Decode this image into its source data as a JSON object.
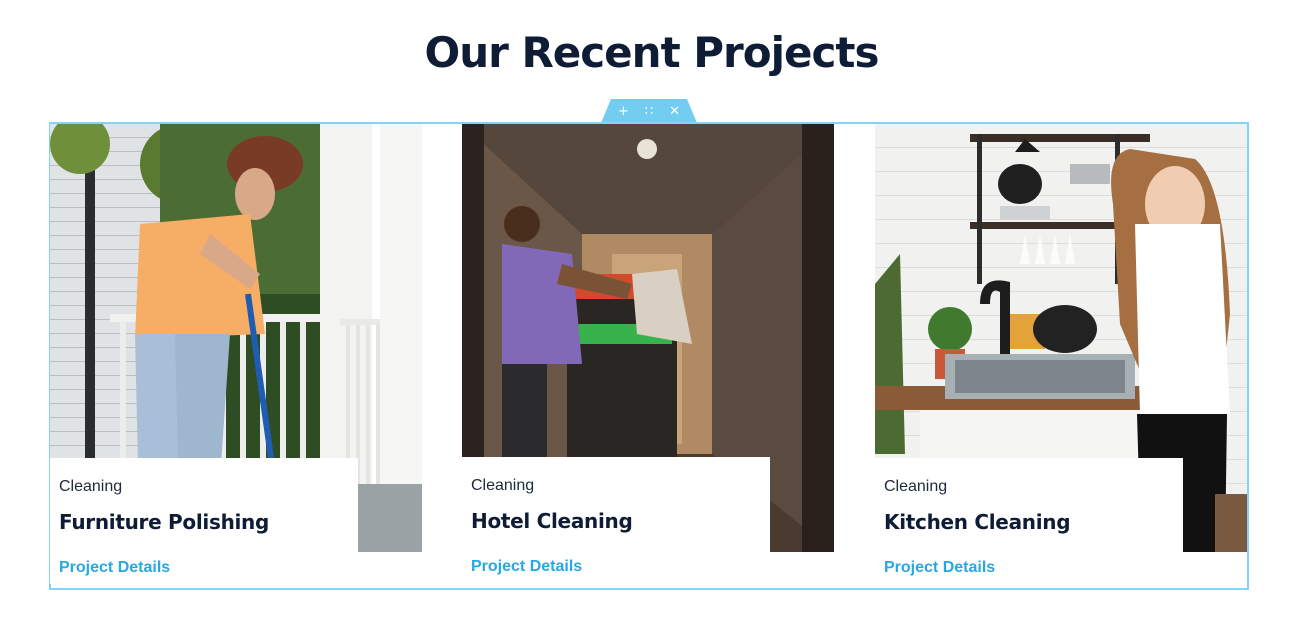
{
  "section": {
    "title": "Our Recent Projects"
  },
  "editor_handle": {
    "add": "+",
    "move": "∷",
    "close": "✕"
  },
  "projects": [
    {
      "category": "Cleaning",
      "title": "Furniture Polishing",
      "link": "Project Details",
      "image": "woman-mopping-porch-photo"
    },
    {
      "category": "Cleaning",
      "title": "Hotel Cleaning",
      "link": "Project Details",
      "image": "man-with-cleaning-cart-hotel-hallway-photo"
    },
    {
      "category": "Cleaning",
      "title": "Kitchen Cleaning",
      "link": "Project Details",
      "image": "woman-washing-dishes-kitchen-photo"
    }
  ],
  "colors": {
    "title": "#0e1c36",
    "accent": "#27a8e0",
    "outline": "#84d3f2"
  }
}
